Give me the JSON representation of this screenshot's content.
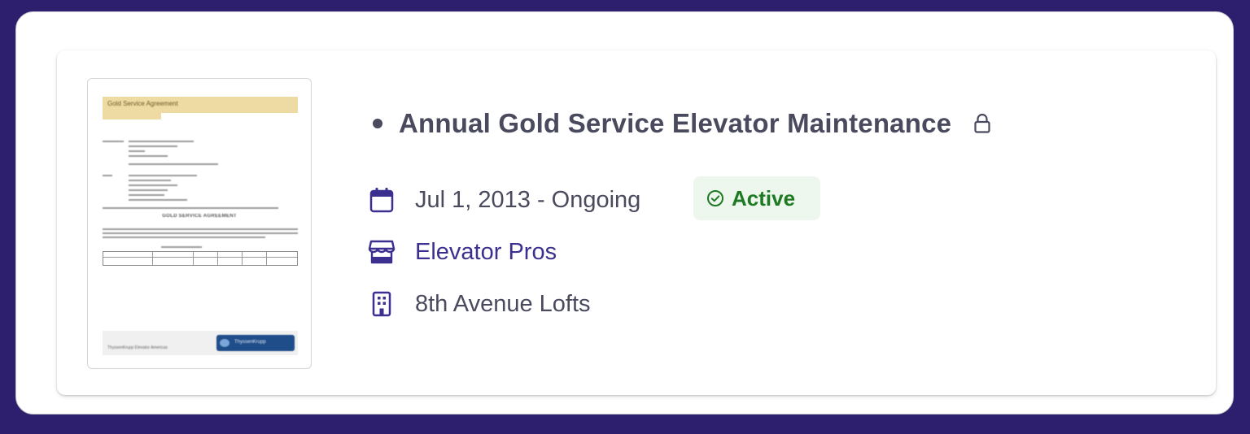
{
  "contract": {
    "title": "Annual Gold Service Elevator Maintenance",
    "date_range": "Jul 1, 2013 - Ongoing",
    "status": "Active",
    "vendor": "Elevator Pros",
    "building": "8th Avenue Lofts"
  },
  "thumbnail": {
    "header": "Gold Service Agreement",
    "section_title": "GOLD SERVICE AGREEMENT",
    "footer_text": "ThyssenKrupp Elevator Americas",
    "footer_logo": "ThyssenKrupp"
  },
  "icons": {
    "lock": "lock-icon",
    "date": "calendar-icon",
    "status": "check-circle-icon",
    "vendor": "storefront-icon",
    "building": "building-icon"
  },
  "colors": {
    "text_primary": "#4a4a5e",
    "link": "#3b2f8f",
    "status_green": "#1e7a22",
    "status_bg": "#eef7ee",
    "frame_background": "#2e1f6e"
  }
}
